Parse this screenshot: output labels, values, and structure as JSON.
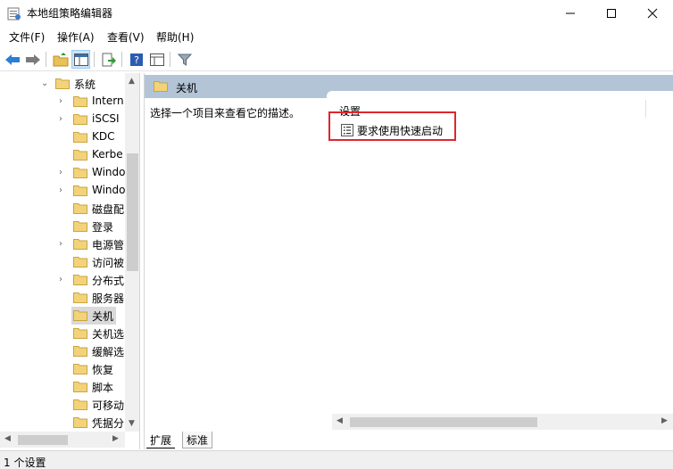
{
  "window": {
    "title": "本地组策略编辑器"
  },
  "menu": [
    {
      "label": "文件(F)"
    },
    {
      "label": "操作(A)"
    },
    {
      "label": "查看(V)"
    },
    {
      "label": "帮助(H)"
    }
  ],
  "tree": {
    "items": [
      {
        "label": "系统",
        "expander": "expanded"
      },
      {
        "label": "Intern",
        "expander": "collapsed"
      },
      {
        "label": "iSCSI",
        "expander": "collapsed"
      },
      {
        "label": "KDC",
        "expander": "none"
      },
      {
        "label": "Kerbe",
        "expander": "none"
      },
      {
        "label": "Windo",
        "expander": "collapsed"
      },
      {
        "label": "Windo",
        "expander": "collapsed"
      },
      {
        "label": "磁盘配",
        "expander": "none"
      },
      {
        "label": "登录",
        "expander": "none"
      },
      {
        "label": "电源管",
        "expander": "collapsed"
      },
      {
        "label": "访问被",
        "expander": "none"
      },
      {
        "label": "分布式",
        "expander": "collapsed"
      },
      {
        "label": "服务器",
        "expander": "none"
      },
      {
        "label": "关机",
        "expander": "none",
        "selected": true
      },
      {
        "label": "关机选",
        "expander": "none"
      },
      {
        "label": "缓解选",
        "expander": "none"
      },
      {
        "label": "恢复",
        "expander": "none"
      },
      {
        "label": "脚本",
        "expander": "none"
      },
      {
        "label": "可移动",
        "expander": "none"
      },
      {
        "label": "凭据分",
        "expander": "none"
      }
    ]
  },
  "right": {
    "header_title": "关机",
    "description": "选择一个项目来查看它的描述。",
    "column_header": "设置",
    "rows": [
      {
        "label": "要求使用快速启动"
      }
    ]
  },
  "tabs": [
    {
      "label": "扩展"
    },
    {
      "label": "标准"
    }
  ],
  "status": {
    "text": "1 个设置"
  },
  "colors": {
    "header_bg": "#b3c4d6",
    "highlight": "#e0252b",
    "selected": "#d9d9d9"
  }
}
